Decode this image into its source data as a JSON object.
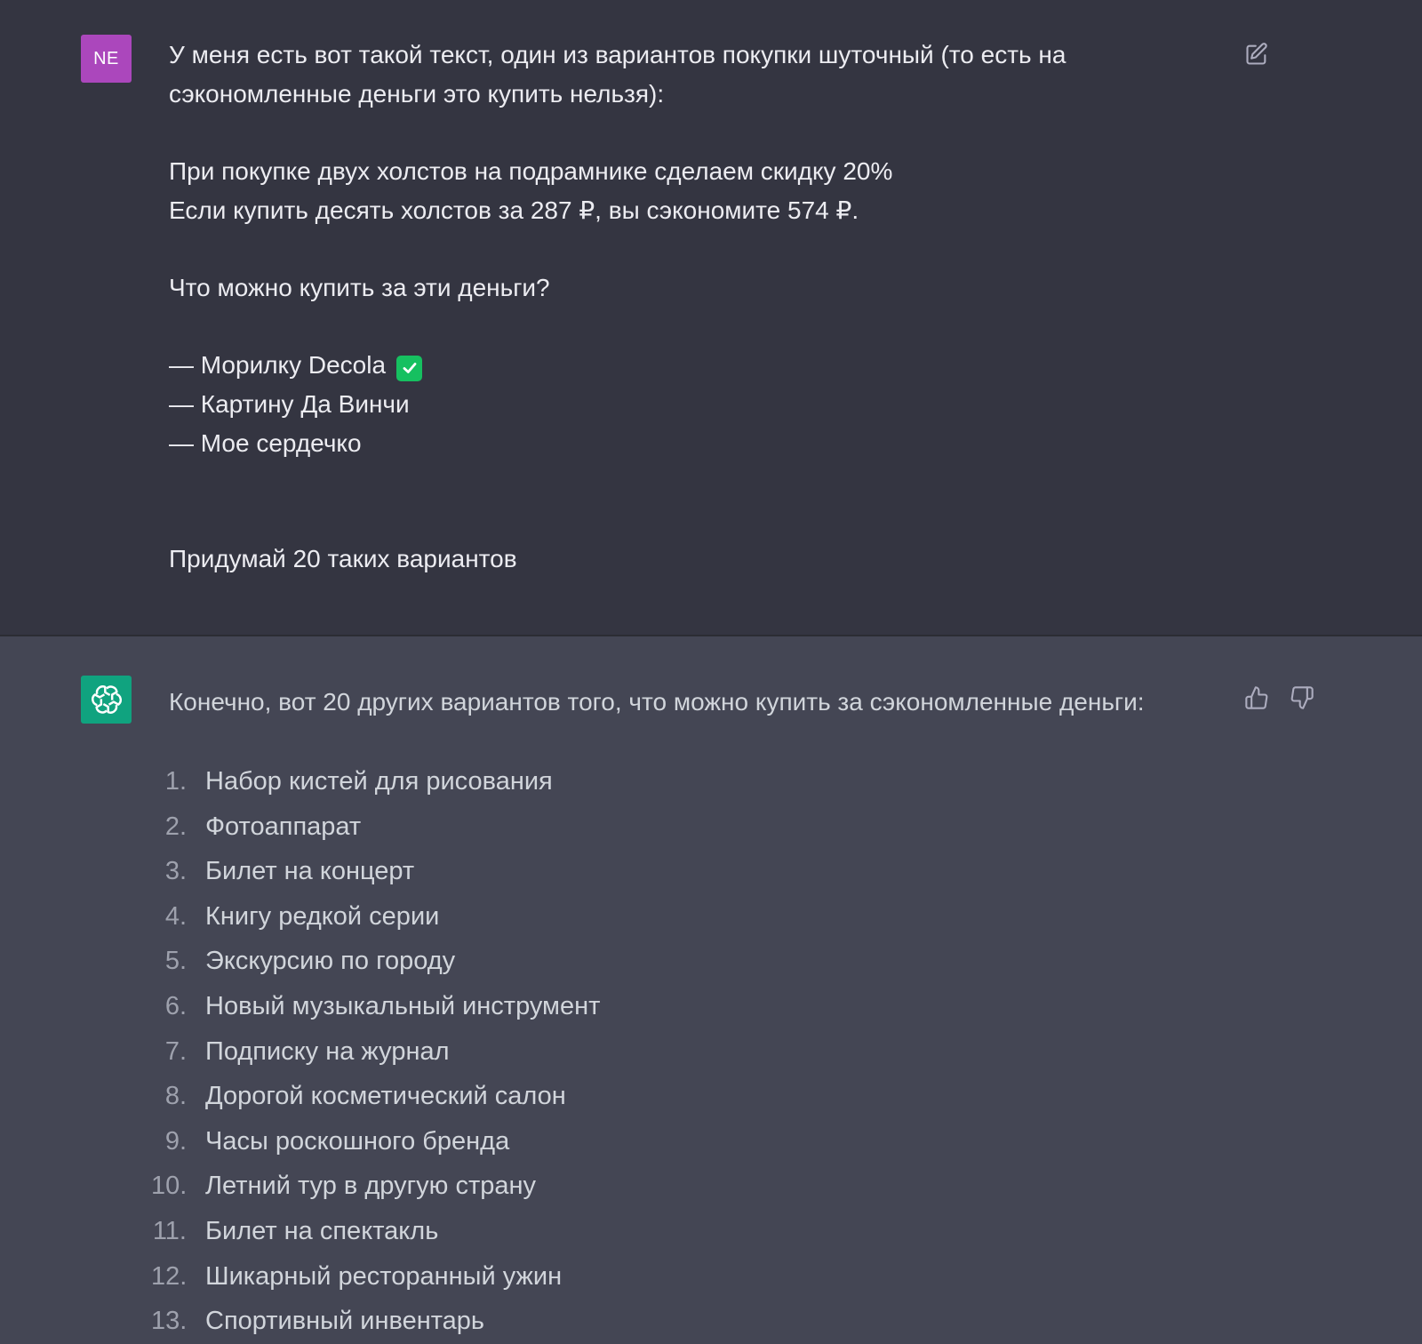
{
  "user_message": {
    "avatar_initials": "NE",
    "lines": [
      "У меня есть вот такой текст, один из вариантов покупки шуточный (то есть на",
      "сэкономленные деньги это купить нельзя):",
      "При покупке двух холстов на подрамнике сделаем скидку 20%",
      "Если купить десять холстов за 287 ₽, вы сэкономите 574 ₽.",
      "Что можно купить за эти деньги?",
      "— Морилку Decola",
      "— Картину Да Винчи",
      "— Мое сердечко",
      "Придумай 20 таких вариантов"
    ],
    "edit_icon": "edit-icon",
    "check_emoji_color": "#16c060",
    "avatar_color": "#ab47bc"
  },
  "assistant_message": {
    "avatar_icon": "openai-logo-icon",
    "avatar_color": "#10a37f",
    "intro": "Конечно, вот 20 других вариантов того, что можно купить за сэкономленные деньги:",
    "items": [
      {
        "num": "1.",
        "text": "Набор кистей для рисования"
      },
      {
        "num": "2.",
        "text": "Фотоаппарат"
      },
      {
        "num": "3.",
        "text": "Билет на концерт"
      },
      {
        "num": "4.",
        "text": "Книгу редкой серии"
      },
      {
        "num": "5.",
        "text": "Экскурсию по городу"
      },
      {
        "num": "6.",
        "text": "Новый музыкальный инструмент"
      },
      {
        "num": "7.",
        "text": "Подписку на журнал"
      },
      {
        "num": "8.",
        "text": "Дорогой косметический салон"
      },
      {
        "num": "9.",
        "text": "Часы роскошного бренда"
      },
      {
        "num": "10.",
        "text": "Летний тур в другую страну"
      },
      {
        "num": "11.",
        "text": "Билет на спектакль"
      },
      {
        "num": "12.",
        "text": "Шикарный ресторанный ужин"
      },
      {
        "num": "13.",
        "text": "Спортивный инвентарь"
      }
    ],
    "thumbs_up_icon": "thumbs-up-icon",
    "thumbs_down_icon": "thumbs-down-icon"
  }
}
